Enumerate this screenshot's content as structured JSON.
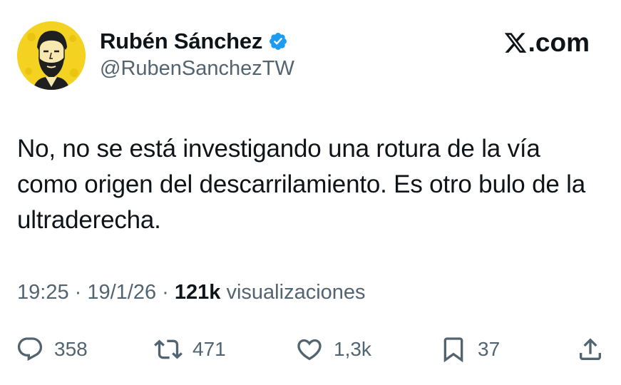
{
  "author": {
    "display_name": "Rubén Sánchez",
    "handle": "@RubenSanchezTW",
    "verified": true,
    "avatar_icon": "bearded-man-avatar",
    "avatar_bg": "#f4d222"
  },
  "brand": {
    "icon": "x-logo-icon",
    "text": ".com"
  },
  "tweet": {
    "text": "No, no se está investigando una rotura de la vía como origen del descarrilamiento. Es otro bulo de la ultraderecha."
  },
  "meta": {
    "time": "19:25",
    "sep1": " · ",
    "date": "19/1/26",
    "sep2": " · ",
    "views_count": "121k",
    "views_label": " visualizaciones"
  },
  "actions": {
    "replies": "358",
    "reposts": "471",
    "likes": "1,3k",
    "bookmarks": "37"
  },
  "colors": {
    "text_primary": "#0f1419",
    "text_secondary": "#536471",
    "verified_blue": "#1d9bf0"
  }
}
